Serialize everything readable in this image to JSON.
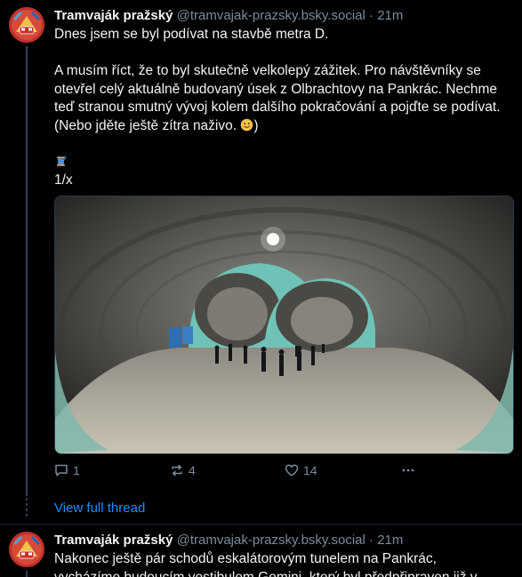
{
  "posts": [
    {
      "author": "Tramvaják pražský",
      "handle": "@tramvajak-prazsky.bsky.social",
      "separator": "·",
      "time": "21m",
      "text": {
        "p1": "Dnes jsem se byl podívat na stavbě metra D.",
        "p2": "A musím říct, že to byl skutečně velkolepý zážitek. Pro návštěvníky se otevřel celý aktuálně budovaný úsek z Olbrachtovy na Pankrác. Nechme teď stranou smutný vývoj kolem dalšího pokračování a pojďte se podívat. (Nebo jděte ještě zítra naživo.",
        "p2_end": ")",
        "thread_emoji": "🧵",
        "counter": "1/x"
      },
      "stats": {
        "replies": "1",
        "reposts": "4",
        "likes": "14"
      },
      "view_thread": "View full thread"
    },
    {
      "author": "Tramvaják pražský",
      "handle": "@tramvajak-prazsky.bsky.social",
      "separator": "·",
      "time": "21m",
      "text": {
        "line1": "Nakonec ještě pár schodů eskalátorovým tunelem na Pankrác,",
        "line2": "vycházíme budoucím vestibulem Gemini, který byl předpřipraven již v"
      }
    }
  ],
  "icons": {
    "reply": "speech-bubble-icon",
    "repost": "repost-arrows-icon",
    "like": "heart-icon",
    "more": "ellipsis-icon",
    "emoji_smile": "smiling-face-emoji",
    "emoji_thread": "spool-of-thread-emoji"
  },
  "colors": {
    "background": "#000000",
    "text": "#f1f3f5",
    "muted": "#7b8b9c",
    "link": "#208bfe",
    "avatar": "#c0302b"
  }
}
